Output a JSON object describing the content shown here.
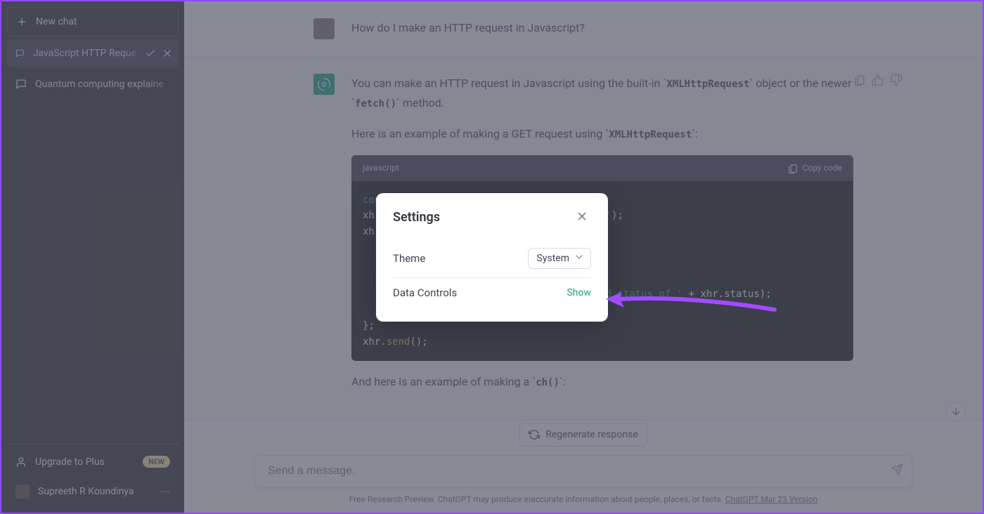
{
  "sidebar": {
    "new_chat": "New chat",
    "items": [
      {
        "label": "JavaScript HTTP Reque",
        "active": true
      },
      {
        "label": "Quantum computing explaine",
        "active": false
      }
    ],
    "upgrade_label": "Upgrade to Plus",
    "upgrade_badge": "NEW",
    "user_name": "Supreeth R Koundinya"
  },
  "conversation": {
    "user_message": "How do I make an HTTP request in Javascript?",
    "assistant_intro_pre": "You can make an HTTP request in Javascript using the built-in ",
    "code1": "XMLHttpRequest",
    "assistant_intro_mid": " object or the newer ",
    "code2": "fetch()",
    "assistant_intro_post": " method.",
    "assistant_para2_pre": "Here is an example of making a GET request using ",
    "code3": "XMLHttpRequest",
    "assistant_para2_post": ":",
    "code_lang": "javascript",
    "copy_label": "Copy code",
    "assistant_para3_pre": "And here is an example of making a",
    "code4": "ch()",
    "assistant_para3_post": ":"
  },
  "composer": {
    "regenerate": "Regenerate response",
    "placeholder": "Send a message.",
    "fineprint_pre": "Free Research Preview. ChatGPT may produce inaccurate information about people, places, or facts. ",
    "fineprint_link": "ChatGPT Mar 23 Version"
  },
  "modal": {
    "title": "Settings",
    "theme_label": "Theme",
    "theme_value": "System",
    "data_controls_label": "Data Controls",
    "data_controls_action": "Show"
  }
}
